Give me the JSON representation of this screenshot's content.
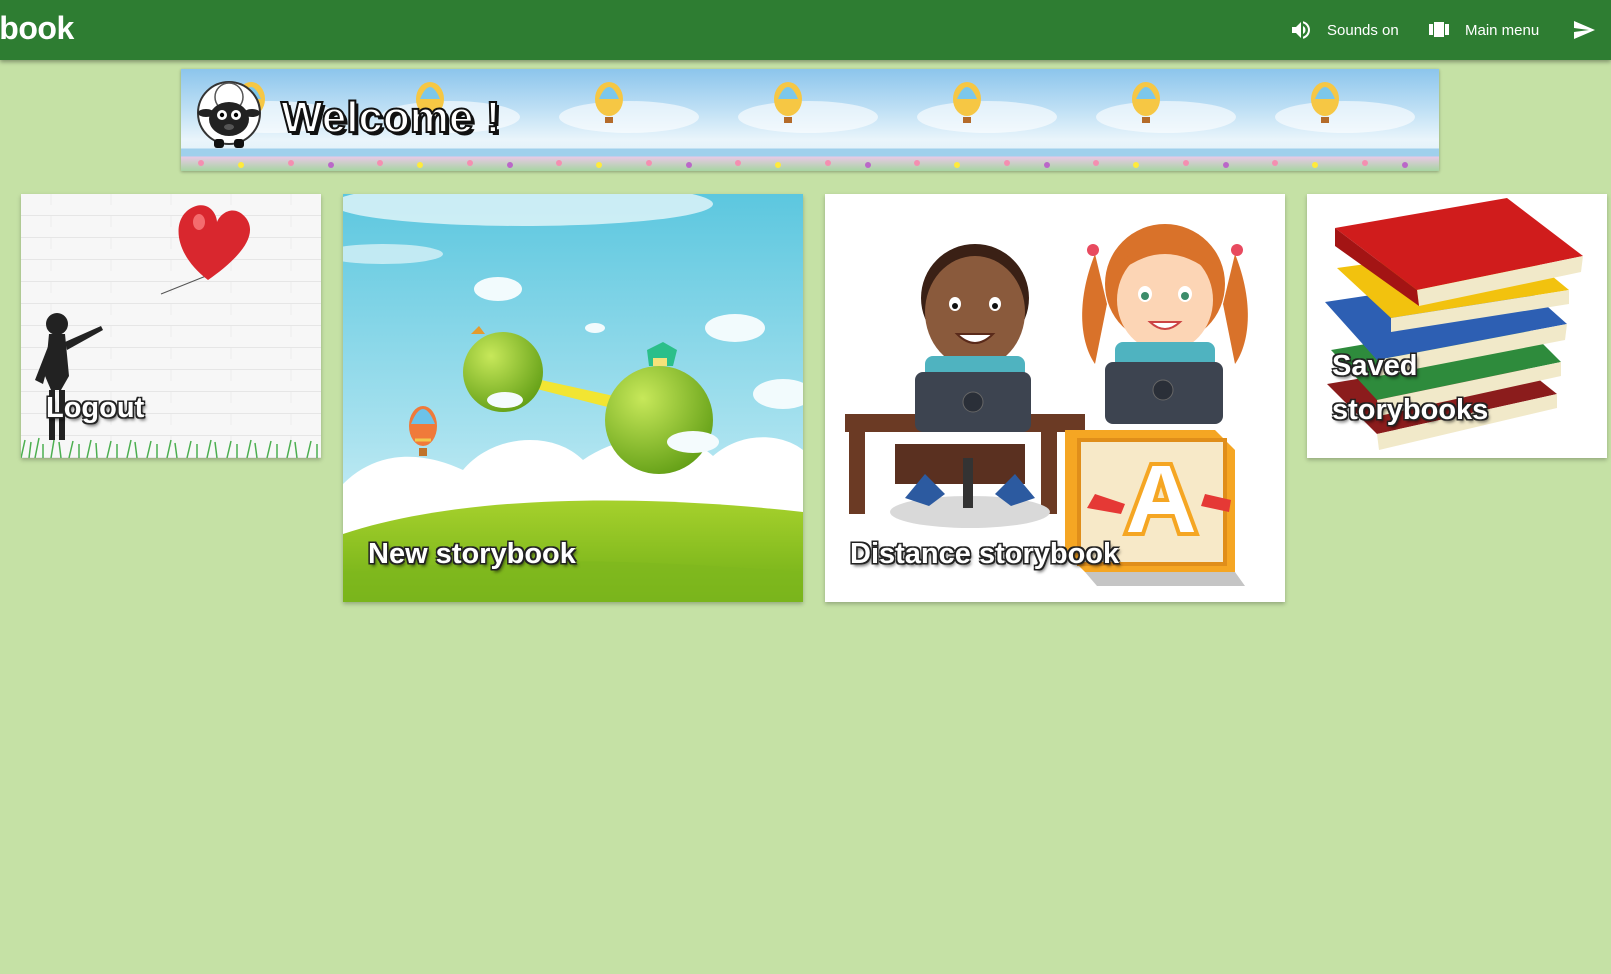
{
  "app": {
    "title_visible": "ybook"
  },
  "appbar": {
    "sounds": {
      "label": "Sounds on",
      "icon": "speaker-icon"
    },
    "main_menu": {
      "label": "Main menu",
      "icon": "menu-cards-icon"
    },
    "send": {
      "label": "",
      "icon": "send-icon"
    }
  },
  "banner": {
    "title": "Welcome !",
    "mascot": "sheep-icon"
  },
  "cards": {
    "logout": {
      "label": "Logout"
    },
    "new_storybook": {
      "label": "New storybook"
    },
    "distance_storybook": {
      "label": "Distance storybook"
    },
    "saved_storybooks": {
      "label_line1": "Saved",
      "label_line2": "storybooks"
    }
  },
  "colors": {
    "appbar": "#2e7d32",
    "background": "#c5e1a5",
    "card": "#ffffff"
  }
}
